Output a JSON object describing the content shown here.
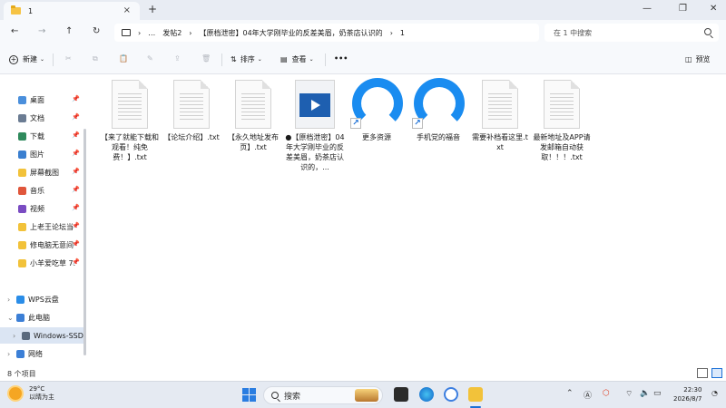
{
  "window": {
    "tab_title": "1",
    "tab_close": "×",
    "new_tab": "+",
    "controls": [
      "—",
      "❐",
      "✕"
    ]
  },
  "nav": {
    "back": "←",
    "forward": "→",
    "up": "↑",
    "refresh": "↻",
    "more": "…",
    "breadcrumbs": [
      "发帖2",
      "【原档泄密】04年大学刚毕业的反差美眉，奶茶店认识的",
      "1"
    ],
    "search_placeholder": "在 1 中搜索"
  },
  "commands": {
    "new": "新建",
    "sort": "排序",
    "view": "查看",
    "more": "•••",
    "preview": "预览"
  },
  "sidebar": {
    "quick_access": [
      {
        "label": "桌面",
        "icon": "desktop-icon",
        "color": "#4a8fdc"
      },
      {
        "label": "文档",
        "icon": "documents-icon",
        "color": "#6b7c93"
      },
      {
        "label": "下载",
        "icon": "downloads-icon",
        "color": "#2f8a5c"
      },
      {
        "label": "图片",
        "icon": "pictures-icon",
        "color": "#3a7fd0"
      },
      {
        "label": "屏幕截图",
        "icon": "folder-icon",
        "color": "#f2c23a"
      },
      {
        "label": "音乐",
        "icon": "music-icon",
        "color": "#e0563b"
      },
      {
        "label": "视频",
        "icon": "videos-icon",
        "color": "#7a4cc2"
      },
      {
        "label": "上老王论坛当",
        "icon": "folder-icon",
        "color": "#f2c23a"
      },
      {
        "label": "修电脑无意间",
        "icon": "folder-icon",
        "color": "#f2c23a"
      },
      {
        "label": "小羊爱吃草 7.",
        "icon": "folder-icon",
        "color": "#f2c23a"
      }
    ],
    "drives": [
      {
        "label": "WPS云盘",
        "icon": "cloud-icon",
        "color": "#2a8de8"
      },
      {
        "label": "此电脑",
        "icon": "computer-icon",
        "color": "#3c7fd6"
      },
      {
        "label": "Windows-SSD",
        "icon": "drive-icon",
        "color": "#5a6a7e"
      },
      {
        "label": "网络",
        "icon": "network-icon",
        "color": "#3c7fd6"
      }
    ]
  },
  "files": [
    {
      "name": "【来了就能下载和观看！纯免费！】.txt",
      "type": "text"
    },
    {
      "name": "【论坛介绍】.txt",
      "type": "text"
    },
    {
      "name": "【永久地址发布页】.txt",
      "type": "text"
    },
    {
      "name": "●【原档泄密】04年大学刚毕业的反差美眉，奶茶店认识的，...",
      "type": "video"
    },
    {
      "name": "更多资源",
      "type": "shortcut"
    },
    {
      "name": "手机党的福音",
      "type": "shortcut"
    },
    {
      "name": "需要补档看这里.txt",
      "type": "text"
    },
    {
      "name": "最新地址及APP请发邮箱自动获取！！！.txt",
      "type": "text"
    }
  ],
  "status": {
    "item_count": "8 个项目"
  },
  "taskbar": {
    "weather_temp": "29°C",
    "weather_desc": "以晴为主",
    "search_label": "搜索",
    "time": "22:30",
    "date": "2026/8/7"
  }
}
